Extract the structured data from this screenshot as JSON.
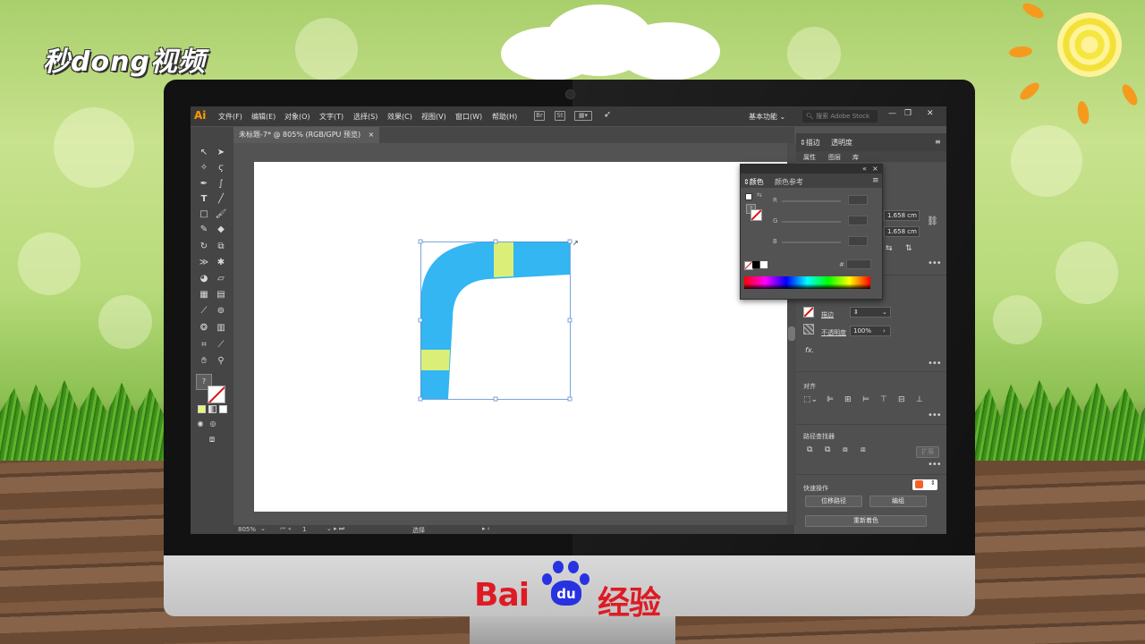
{
  "watermark": {
    "logo_text": "秒dong视频"
  },
  "brand": {
    "baidu_left": "Bai",
    "baidu_paw": "du",
    "baidu_right": "经验",
    "red": "#de1b24",
    "blue": "#2932e1"
  },
  "app": {
    "logo": "Ai",
    "menu": [
      "文件(F)",
      "编辑(E)",
      "对象(O)",
      "文字(T)",
      "选择(S)",
      "效果(C)",
      "视图(V)",
      "窗口(W)",
      "帮助(H)"
    ],
    "menubar_icons": [
      "Br",
      "St"
    ],
    "workspace_label": "基本功能",
    "search_placeholder": "搜索 Adobe Stock",
    "window_buttons": [
      "—",
      "❐",
      "✕"
    ]
  },
  "document": {
    "tab_label": "未标题-7* @ 805% (RGB/GPU 预览)",
    "tab_close": "×",
    "shape_fill": "#33b6f2",
    "stripe_fill": "#dbef78"
  },
  "tools": {
    "question_mark": "?"
  },
  "statusbar": {
    "zoom": "805%",
    "artboard_number": "1",
    "tool_name": "选择"
  },
  "right_panel": {
    "tab_stroke": "描边",
    "tab_transparency": "透明度",
    "subtabs": [
      "属性",
      "图层",
      "库"
    ],
    "width_value": "1.658 cm",
    "height_value": "1.658 cm",
    "stroke_label": "描边",
    "opacity_label": "不透明度",
    "opacity_value": "100%",
    "fx_label": "fx.",
    "align_label": "对齐",
    "pathfinder_label": "路径查找器",
    "expand_label": "扩展",
    "quick_actions_label": "快速操作",
    "offset_path_button": "位移路径",
    "group_button": "编组",
    "recolor_button": "重新着色",
    "more": "•••"
  },
  "color_panel": {
    "tab_color": "颜色",
    "tab_color_guide": "颜色参考",
    "channels": [
      "R",
      "G",
      "B"
    ],
    "hex_symbol": "#"
  }
}
